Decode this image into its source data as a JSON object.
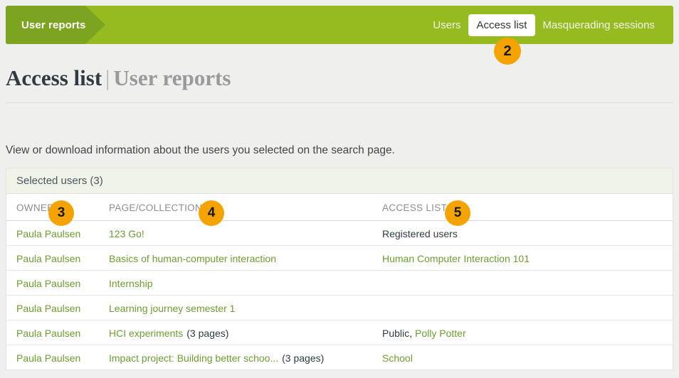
{
  "nav": {
    "brand": "User reports",
    "links": [
      {
        "label": "Users",
        "active": false
      },
      {
        "label": "Access list",
        "active": true
      },
      {
        "label": "Masquerading sessions",
        "active": false
      }
    ]
  },
  "heading": {
    "current": "Access list",
    "separator": "|",
    "parent": "User reports"
  },
  "intro": "View or download information about the users you selected on the search page.",
  "table": {
    "caption": "Selected users (3)",
    "columns": [
      "OWNER",
      "PAGE/COLLECTION",
      "ACCESS LIST"
    ],
    "rows": [
      {
        "owner": "Paula Paulsen",
        "page": "123 Go!",
        "page_suffix": "",
        "access_plain": "Registered users",
        "access_comma": "",
        "access_link": ""
      },
      {
        "owner": "Paula Paulsen",
        "page": "Basics of human-computer interaction",
        "page_suffix": "",
        "access_plain": "",
        "access_comma": "",
        "access_link": "Human Computer Interaction 101"
      },
      {
        "owner": "Paula Paulsen",
        "page": "Internship",
        "page_suffix": "",
        "access_plain": "",
        "access_comma": "",
        "access_link": ""
      },
      {
        "owner": "Paula Paulsen",
        "page": "Learning journey semester 1",
        "page_suffix": "",
        "access_plain": "",
        "access_comma": "",
        "access_link": ""
      },
      {
        "owner": "Paula Paulsen",
        "page": "HCI experiments",
        "page_suffix": "(3 pages)",
        "access_plain": "Public,",
        "access_comma": "",
        "access_link": "Polly Potter"
      },
      {
        "owner": "Paula Paulsen",
        "page": "Impact project: Building better schoo...",
        "page_suffix": "(3 pages)",
        "access_plain": "",
        "access_comma": "",
        "access_link": "School"
      }
    ]
  },
  "markers": [
    {
      "label": "2"
    },
    {
      "label": "3"
    },
    {
      "label": "4"
    },
    {
      "label": "5"
    }
  ],
  "colors": {
    "nav_green": "#95bb20",
    "nav_accent_green": "#7da420",
    "link_green": "#6c9e2f",
    "marker_orange": "#f5a300"
  }
}
